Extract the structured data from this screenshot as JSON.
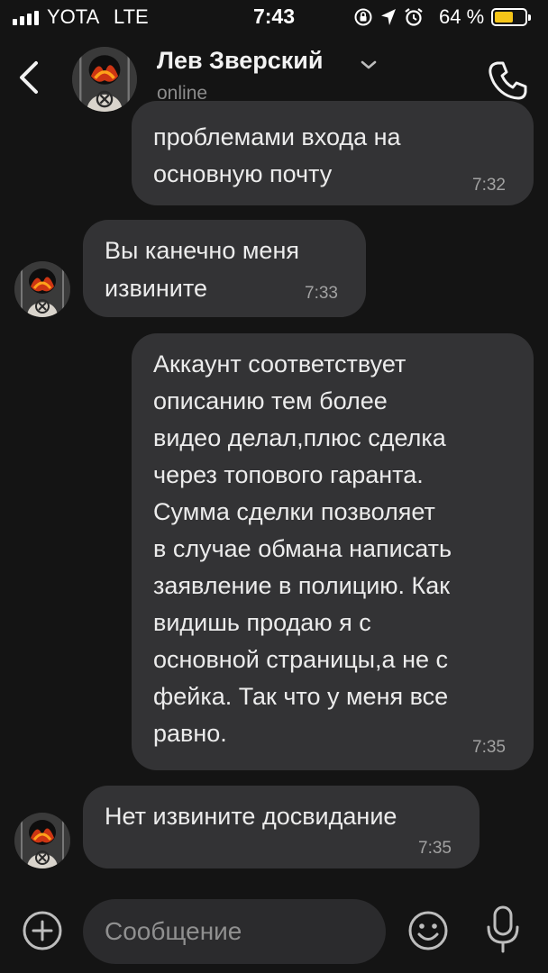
{
  "status_bar": {
    "carrier": "YOTA",
    "network": "LTE",
    "time": "7:43",
    "battery_percent": "64 %",
    "battery_level": 0.64,
    "icons": [
      "signal-icon",
      "screen-lock-icon",
      "location-icon",
      "alarm-icon",
      "battery-icon"
    ]
  },
  "header": {
    "contact_name": "Лев Зверский",
    "status": "online",
    "back_icon": "chevron-left-icon",
    "menu_icon": "chevron-down-icon",
    "call_icon": "phone-icon"
  },
  "messages": [
    {
      "direction": "out",
      "lines": [
        "проблемами входа на",
        "основную почту"
      ],
      "time": "7:32"
    },
    {
      "direction": "in",
      "lines": [
        "Вы канечно меня",
        "извините"
      ],
      "time": "7:33"
    },
    {
      "direction": "out",
      "lines": [
        "Аккаунт соответствует",
        "описанию тем более",
        "видео делал,плюс сделка",
        "через топового гаранта.",
        "Сумма сделки позволяет",
        "в случае обмана написать",
        "заявление в полицию. Как",
        "видишь продаю я с",
        "основной страницы,а не с",
        "фейка. Так что у меня все",
        "равно."
      ],
      "time": "7:35"
    },
    {
      "direction": "in",
      "lines": [
        "Нет извините досвидание"
      ],
      "time": "7:35"
    }
  ],
  "composer": {
    "placeholder": "Сообщение",
    "attach_icon": "plus-icon",
    "emoji_icon": "emoji-icon",
    "voice_icon": "microphone-icon"
  },
  "colors": {
    "background": "#141414",
    "bubble": "#333335",
    "battery": "#f5c518"
  }
}
